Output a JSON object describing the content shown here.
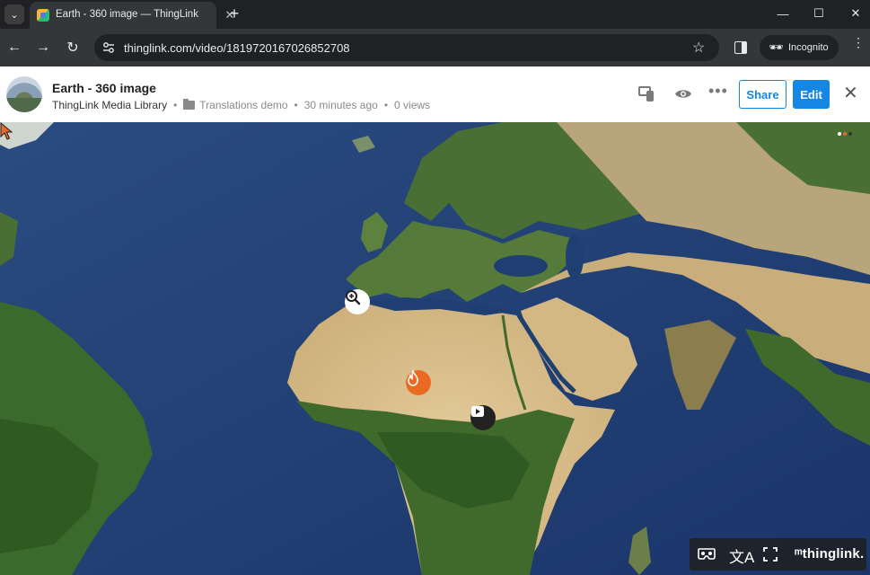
{
  "browser": {
    "tab": {
      "title": "Earth - 360 image — ThingLink"
    },
    "address": {
      "url": "thinglink.com/video/1819720167026852708"
    },
    "incognito_label": "Incognito"
  },
  "header": {
    "title": "Earth - 360 image",
    "library": "ThingLink Media Library",
    "folder": "Translations demo",
    "time": "30 minutes ago",
    "views": "0 views",
    "separator": "•",
    "share_label": "Share",
    "edit_label": "Edit"
  },
  "viewer": {
    "hotspots": [
      {
        "name": "zoom-in-icon",
        "color": "#ffffff"
      },
      {
        "name": "fire-icon",
        "color": "#ea6a23"
      },
      {
        "name": "video-play-icon",
        "color": "#222222"
      }
    ],
    "footer": {
      "brand": "ᵐthinglink."
    }
  },
  "colors": {
    "accent": "#1487e5",
    "ocean": "#1f3f73",
    "desert": "#d9c08e",
    "forest": "#3f6a2c"
  }
}
